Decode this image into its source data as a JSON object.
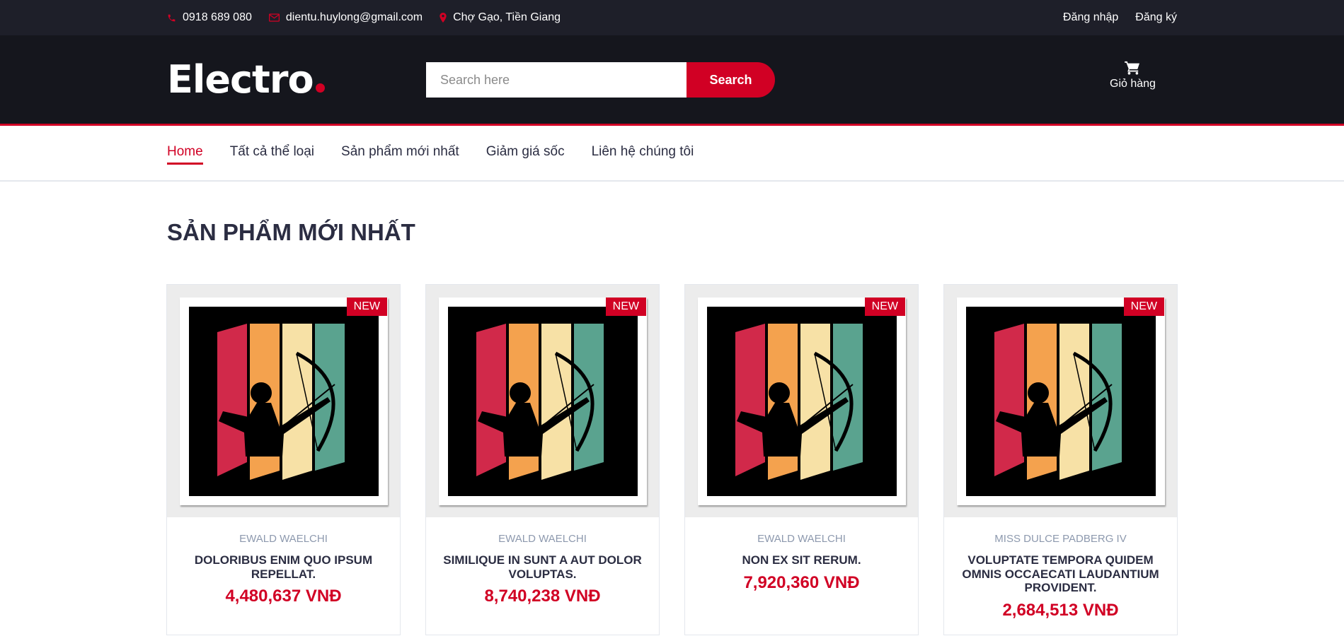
{
  "topbar": {
    "phone": "0918 689 080",
    "email": "dientu.huylong@gmail.com",
    "address": "Chợ Gạo, Tiền Giang",
    "login": "Đăng nhập",
    "register": "Đăng ký"
  },
  "header": {
    "logo": "Electro",
    "search_placeholder": "Search here",
    "search_button": "Search",
    "cart_label": "Giỏ hàng"
  },
  "nav": {
    "items": [
      "Home",
      "Tất cả thể loại",
      "Sản phẩm mới nhất",
      "Giảm giá sốc",
      "Liên hệ chúng tôi"
    ]
  },
  "section": {
    "title": "SẢN PHẨM MỚI NHẤT"
  },
  "products": [
    {
      "badge": "NEW",
      "brand": "EWALD WAELCHI",
      "name": "DOLORIBUS ENIM QUO IPSUM REPELLAT.",
      "price": "4,480,637 VNĐ"
    },
    {
      "badge": "NEW",
      "brand": "EWALD WAELCHI",
      "name": "SIMILIQUE IN SUNT A AUT DOLOR VOLUPTAS.",
      "price": "8,740,238 VNĐ"
    },
    {
      "badge": "NEW",
      "brand": "EWALD WAELCHI",
      "name": "NON EX SIT RERUM.",
      "price": "7,920,360 VNĐ"
    },
    {
      "badge": "NEW",
      "brand": "MISS DULCE PADBERG IV",
      "name": "VOLUPTATE TEMPORA QUIDEM OMNIS OCCAECATI LAUDANTIUM PROVIDENT.",
      "price": "2,684,513 VNĐ"
    }
  ],
  "colors": {
    "accent": "#d10024",
    "dark": "#15161d",
    "topbar": "#1e1f29",
    "text": "#2b2d42"
  }
}
